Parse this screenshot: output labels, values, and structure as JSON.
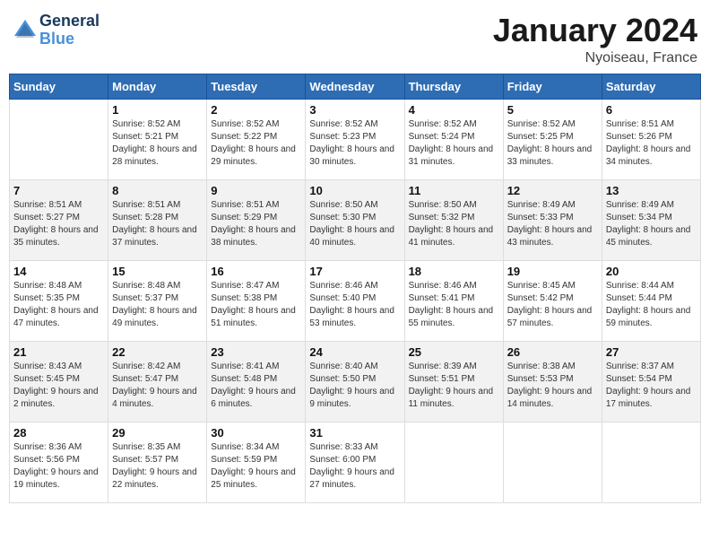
{
  "header": {
    "logo_line1": "General",
    "logo_line2": "Blue",
    "month_title": "January 2024",
    "location": "Nyoiseau, France"
  },
  "weekdays": [
    "Sunday",
    "Monday",
    "Tuesday",
    "Wednesday",
    "Thursday",
    "Friday",
    "Saturday"
  ],
  "weeks": [
    [
      {
        "day": "",
        "sunrise": "",
        "sunset": "",
        "daylight": ""
      },
      {
        "day": "1",
        "sunrise": "Sunrise: 8:52 AM",
        "sunset": "Sunset: 5:21 PM",
        "daylight": "Daylight: 8 hours and 28 minutes."
      },
      {
        "day": "2",
        "sunrise": "Sunrise: 8:52 AM",
        "sunset": "Sunset: 5:22 PM",
        "daylight": "Daylight: 8 hours and 29 minutes."
      },
      {
        "day": "3",
        "sunrise": "Sunrise: 8:52 AM",
        "sunset": "Sunset: 5:23 PM",
        "daylight": "Daylight: 8 hours and 30 minutes."
      },
      {
        "day": "4",
        "sunrise": "Sunrise: 8:52 AM",
        "sunset": "Sunset: 5:24 PM",
        "daylight": "Daylight: 8 hours and 31 minutes."
      },
      {
        "day": "5",
        "sunrise": "Sunrise: 8:52 AM",
        "sunset": "Sunset: 5:25 PM",
        "daylight": "Daylight: 8 hours and 33 minutes."
      },
      {
        "day": "6",
        "sunrise": "Sunrise: 8:51 AM",
        "sunset": "Sunset: 5:26 PM",
        "daylight": "Daylight: 8 hours and 34 minutes."
      }
    ],
    [
      {
        "day": "7",
        "sunrise": "Sunrise: 8:51 AM",
        "sunset": "Sunset: 5:27 PM",
        "daylight": "Daylight: 8 hours and 35 minutes."
      },
      {
        "day": "8",
        "sunrise": "Sunrise: 8:51 AM",
        "sunset": "Sunset: 5:28 PM",
        "daylight": "Daylight: 8 hours and 37 minutes."
      },
      {
        "day": "9",
        "sunrise": "Sunrise: 8:51 AM",
        "sunset": "Sunset: 5:29 PM",
        "daylight": "Daylight: 8 hours and 38 minutes."
      },
      {
        "day": "10",
        "sunrise": "Sunrise: 8:50 AM",
        "sunset": "Sunset: 5:30 PM",
        "daylight": "Daylight: 8 hours and 40 minutes."
      },
      {
        "day": "11",
        "sunrise": "Sunrise: 8:50 AM",
        "sunset": "Sunset: 5:32 PM",
        "daylight": "Daylight: 8 hours and 41 minutes."
      },
      {
        "day": "12",
        "sunrise": "Sunrise: 8:49 AM",
        "sunset": "Sunset: 5:33 PM",
        "daylight": "Daylight: 8 hours and 43 minutes."
      },
      {
        "day": "13",
        "sunrise": "Sunrise: 8:49 AM",
        "sunset": "Sunset: 5:34 PM",
        "daylight": "Daylight: 8 hours and 45 minutes."
      }
    ],
    [
      {
        "day": "14",
        "sunrise": "Sunrise: 8:48 AM",
        "sunset": "Sunset: 5:35 PM",
        "daylight": "Daylight: 8 hours and 47 minutes."
      },
      {
        "day": "15",
        "sunrise": "Sunrise: 8:48 AM",
        "sunset": "Sunset: 5:37 PM",
        "daylight": "Daylight: 8 hours and 49 minutes."
      },
      {
        "day": "16",
        "sunrise": "Sunrise: 8:47 AM",
        "sunset": "Sunset: 5:38 PM",
        "daylight": "Daylight: 8 hours and 51 minutes."
      },
      {
        "day": "17",
        "sunrise": "Sunrise: 8:46 AM",
        "sunset": "Sunset: 5:40 PM",
        "daylight": "Daylight: 8 hours and 53 minutes."
      },
      {
        "day": "18",
        "sunrise": "Sunrise: 8:46 AM",
        "sunset": "Sunset: 5:41 PM",
        "daylight": "Daylight: 8 hours and 55 minutes."
      },
      {
        "day": "19",
        "sunrise": "Sunrise: 8:45 AM",
        "sunset": "Sunset: 5:42 PM",
        "daylight": "Daylight: 8 hours and 57 minutes."
      },
      {
        "day": "20",
        "sunrise": "Sunrise: 8:44 AM",
        "sunset": "Sunset: 5:44 PM",
        "daylight": "Daylight: 8 hours and 59 minutes."
      }
    ],
    [
      {
        "day": "21",
        "sunrise": "Sunrise: 8:43 AM",
        "sunset": "Sunset: 5:45 PM",
        "daylight": "Daylight: 9 hours and 2 minutes."
      },
      {
        "day": "22",
        "sunrise": "Sunrise: 8:42 AM",
        "sunset": "Sunset: 5:47 PM",
        "daylight": "Daylight: 9 hours and 4 minutes."
      },
      {
        "day": "23",
        "sunrise": "Sunrise: 8:41 AM",
        "sunset": "Sunset: 5:48 PM",
        "daylight": "Daylight: 9 hours and 6 minutes."
      },
      {
        "day": "24",
        "sunrise": "Sunrise: 8:40 AM",
        "sunset": "Sunset: 5:50 PM",
        "daylight": "Daylight: 9 hours and 9 minutes."
      },
      {
        "day": "25",
        "sunrise": "Sunrise: 8:39 AM",
        "sunset": "Sunset: 5:51 PM",
        "daylight": "Daylight: 9 hours and 11 minutes."
      },
      {
        "day": "26",
        "sunrise": "Sunrise: 8:38 AM",
        "sunset": "Sunset: 5:53 PM",
        "daylight": "Daylight: 9 hours and 14 minutes."
      },
      {
        "day": "27",
        "sunrise": "Sunrise: 8:37 AM",
        "sunset": "Sunset: 5:54 PM",
        "daylight": "Daylight: 9 hours and 17 minutes."
      }
    ],
    [
      {
        "day": "28",
        "sunrise": "Sunrise: 8:36 AM",
        "sunset": "Sunset: 5:56 PM",
        "daylight": "Daylight: 9 hours and 19 minutes."
      },
      {
        "day": "29",
        "sunrise": "Sunrise: 8:35 AM",
        "sunset": "Sunset: 5:57 PM",
        "daylight": "Daylight: 9 hours and 22 minutes."
      },
      {
        "day": "30",
        "sunrise": "Sunrise: 8:34 AM",
        "sunset": "Sunset: 5:59 PM",
        "daylight": "Daylight: 9 hours and 25 minutes."
      },
      {
        "day": "31",
        "sunrise": "Sunrise: 8:33 AM",
        "sunset": "Sunset: 6:00 PM",
        "daylight": "Daylight: 9 hours and 27 minutes."
      },
      {
        "day": "",
        "sunrise": "",
        "sunset": "",
        "daylight": ""
      },
      {
        "day": "",
        "sunrise": "",
        "sunset": "",
        "daylight": ""
      },
      {
        "day": "",
        "sunrise": "",
        "sunset": "",
        "daylight": ""
      }
    ]
  ]
}
